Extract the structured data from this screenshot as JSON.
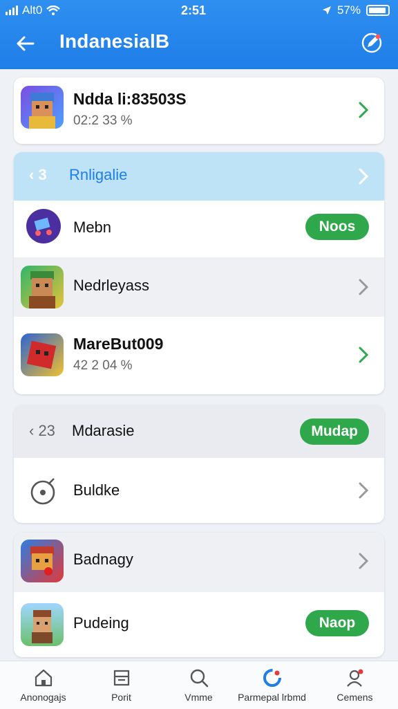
{
  "status_bar": {
    "carrier": "Alt0",
    "time": "2:51",
    "battery": "57%"
  },
  "header": {
    "title": "IndanesialB"
  },
  "card1": {
    "label": "Ndda li:83503S",
    "sub": "02:2 33 %"
  },
  "section1": {
    "prefix": "‹ 3",
    "label": "Rnligalie"
  },
  "card2": {
    "rows": [
      {
        "label": "Mebn",
        "action": "Noos"
      },
      {
        "label": "Nedrleyass"
      },
      {
        "label": "MareBut009",
        "sub": "42 2 04 %"
      }
    ]
  },
  "section2": {
    "prefix": "‹ 23",
    "label": "Mdarasie",
    "action": "Mudap"
  },
  "card3": {
    "rows": [
      {
        "label": "Buldke"
      }
    ]
  },
  "card4": {
    "rows": [
      {
        "label": "Badnagy"
      },
      {
        "label": "Pudeing",
        "action": "Naop"
      }
    ]
  },
  "bottom_nav": [
    {
      "label": "Anonogajs",
      "icon": "home-icon"
    },
    {
      "label": "Porit",
      "icon": "inbox-icon"
    },
    {
      "label": "Vmme",
      "icon": "search-icon"
    },
    {
      "label": "Parmepal lrbmd",
      "icon": "refresh-icon"
    },
    {
      "label": "Cemens",
      "icon": "people-icon"
    }
  ],
  "colors": {
    "header": "#1f7ee8",
    "accent_green": "#2ea84a",
    "section_blue": "#bfe3f6",
    "section_grey": "#e9ebf0"
  }
}
